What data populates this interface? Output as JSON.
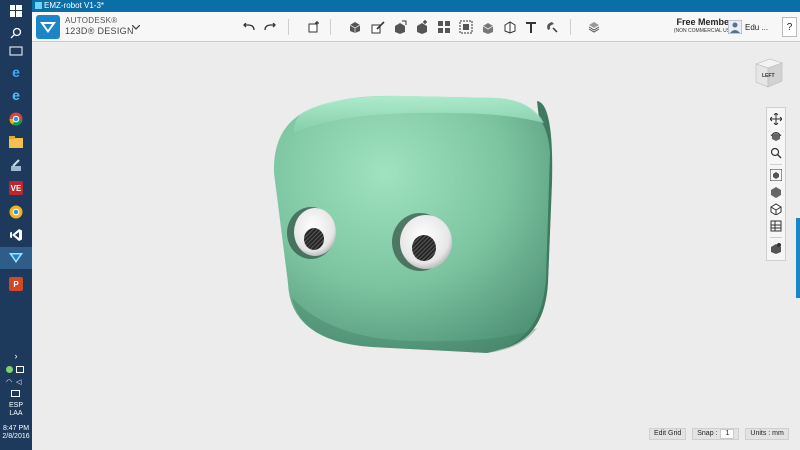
{
  "window": {
    "title": "EMZ-robot V1-3*"
  },
  "brand": {
    "line1": "AUTODESK®",
    "line2": "123D® DESIGN"
  },
  "account": {
    "member_title": "Free Member",
    "member_subtitle": "(NON COMMERCIAL USE)",
    "user_name": "Edu ...",
    "help_label": "?"
  },
  "viewcube": {
    "face": "LEFT"
  },
  "status": {
    "edit_grid": "Edit Grid",
    "snap_label": "Snap :",
    "snap_value": "1",
    "units": "Units : mm"
  },
  "tray": {
    "lang1": "ESP",
    "lang2": "LAA",
    "time": "8:47 PM",
    "date": "2/8/2016"
  },
  "taskbar": {
    "vs_label": "VE",
    "ppt_label": "P"
  },
  "colors": {
    "accent": "#0b6fa7",
    "model": "#7fc9a4",
    "taskbar": "#1d3a5c"
  }
}
